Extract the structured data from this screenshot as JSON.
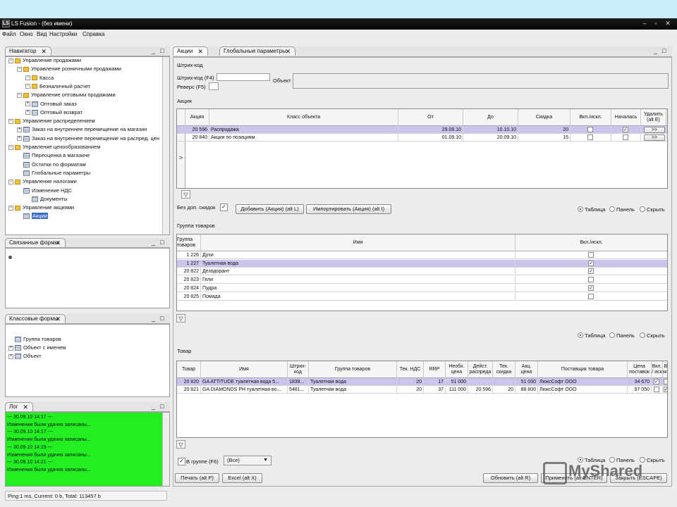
{
  "window": {
    "title": "LS Fusion - (без имени)",
    "logo": "LS"
  },
  "menu": [
    "Файл",
    "Окно",
    "Вид",
    "Настройки",
    "Справка"
  ],
  "navigator": {
    "tab": "Навигатор",
    "items": [
      {
        "label": "Управление продажами",
        "icon": "folder"
      },
      {
        "label": "Управление розничными продажами",
        "icon": "folder"
      },
      {
        "label": "Касса",
        "icon": "folder"
      },
      {
        "label": "Безналичный расчет",
        "icon": "folder"
      },
      {
        "label": "Управление оптовыми продажами",
        "icon": "folder"
      },
      {
        "label": "Оптовый заказ",
        "icon": "form"
      },
      {
        "label": "Оптовый возврат",
        "icon": "form"
      },
      {
        "label": "Управление распределением",
        "icon": "folder"
      },
      {
        "label": "Заказ на внутреннее перемещение на магазин",
        "icon": "form"
      },
      {
        "label": "Заказ на внутреннее перемещение на распред. цен",
        "icon": "form"
      },
      {
        "label": "Управление ценообразованием",
        "icon": "folder"
      },
      {
        "label": "Переоценка в магазине",
        "icon": "form"
      },
      {
        "label": "Остатки по форматам",
        "icon": "form"
      },
      {
        "label": "Глобальные параметры",
        "icon": "form"
      },
      {
        "label": "Управление налогами",
        "icon": "folder"
      },
      {
        "label": "Изменение НДС",
        "icon": "form"
      },
      {
        "label": "Документы",
        "icon": "form"
      },
      {
        "label": "Управление акциями",
        "icon": "folder"
      },
      {
        "label": "Акции",
        "icon": "form"
      }
    ]
  },
  "related": {
    "tab": "Связанные формы"
  },
  "classForms": {
    "tab": "Классовые формы",
    "items": [
      "Группа товаров",
      "Объект с именем",
      "Объект"
    ]
  },
  "log": {
    "tab": "Лог",
    "lines": [
      "--- 30.09.10 14:17 ---",
      "Изменения были удачно записаны...",
      "--- 30.09.10 14:17 ---",
      "Изменения были удачно записаны...",
      "--- 30.09.10 14:19 ---",
      "Изменения были удачно записаны...",
      "--- 30.09.10 14:21 ---",
      "Изменения были удачно записаны..."
    ]
  },
  "status": "Ping:1 ms, Current: 0 b, Total: 113457 b",
  "tabs": [
    "Акции",
    "Глобальные параметры"
  ],
  "barcode": {
    "section": "Штрих-код",
    "field_label": "Штрих-код (F4)",
    "object_label": "Объект",
    "reverse_label": "Реверс (F5)"
  },
  "promo": {
    "section": "Акция",
    "headers": [
      "Акция",
      "Класс объекта",
      "От",
      "До",
      "Скидка",
      "Вкл./искл.",
      "Началась",
      "Удалить (alt E)"
    ],
    "rows": [
      {
        "id": "20 596",
        "cls": "Распродажа",
        "from": "29.09.10",
        "to": "10.10.10",
        "disc": "20",
        "incl": false,
        "started": true,
        "del": ">>"
      },
      {
        "id": "20 840",
        "cls": "Акции по позициям",
        "from": "01.09.10",
        "to": "20.09.10",
        "disc": "15",
        "incl": false,
        "started": false,
        "del": ">>"
      }
    ],
    "nodisc_label": "Без доп. скидок",
    "add_btn": "Добавить (Акция) (alt L)",
    "import_btn": "Импортировать (Акция) (alt I)"
  },
  "view": {
    "table": "Таблица",
    "panel": "Панель",
    "hide": "Скрыть"
  },
  "groups": {
    "section": "Группа товаров",
    "headers": [
      "Группа товаров",
      "Имя",
      "Вкл./искл."
    ],
    "rows": [
      {
        "id": "1 226",
        "name": "Духи",
        "chk": false
      },
      {
        "id": "1 227",
        "name": "Туалетная вода",
        "chk": true
      },
      {
        "id": "20 822",
        "name": "Дезодорант",
        "chk": true
      },
      {
        "id": "20 823",
        "name": "Гели",
        "chk": false
      },
      {
        "id": "20 824",
        "name": "Пудра",
        "chk": true
      },
      {
        "id": "20 825",
        "name": "Помада",
        "chk": false
      }
    ]
  },
  "goods": {
    "section": "Товар",
    "headers": [
      "Товар",
      "Имя",
      "Штрих-код",
      "Группа товаров",
      "Тек. НДС",
      "RRP",
      "Необх. цена",
      "Дейст. распреда",
      "Тек. скидка",
      "Акц. цена",
      "Поставщик товара",
      "Цена поставок",
      "Вкл. / иск",
      "В акц"
    ],
    "rows": [
      {
        "id": "20 820",
        "name": "GA ATTITUDE туалетная вода 5...",
        "bar": "1838...",
        "grp": "Туалетная вода",
        "nds": "20",
        "rrp": "17",
        "need": "51 000",
        "act": "",
        "disc": "",
        "price": "51 000",
        "sup": "ЛюксСофт ООО",
        "cost": "34 670",
        "c1": true,
        "c2": false
      },
      {
        "id": "20 821",
        "name": "GA DIAMONDS PH туалетная во...",
        "bar": "5481...",
        "grp": "Туалетная вода",
        "nds": "20",
        "rrp": "37",
        "need": "111 000",
        "act": "20 596",
        "disc": "20",
        "price": "88 800",
        "sup": "ЛюксСофт ООО",
        "cost": "97 050",
        "c1": false,
        "c2": true
      }
    ],
    "ingroup_label": "В группе (F6)",
    "select": "(Все)"
  },
  "bottom": {
    "print": "Печать (alt P)",
    "excel": "Excel (alt X)",
    "refresh": "Обновить (alt R)",
    "apply": "Применить (alt ENTER)",
    "close": "Закрыть (ESCAPE)"
  },
  "watermark": "MyShared"
}
